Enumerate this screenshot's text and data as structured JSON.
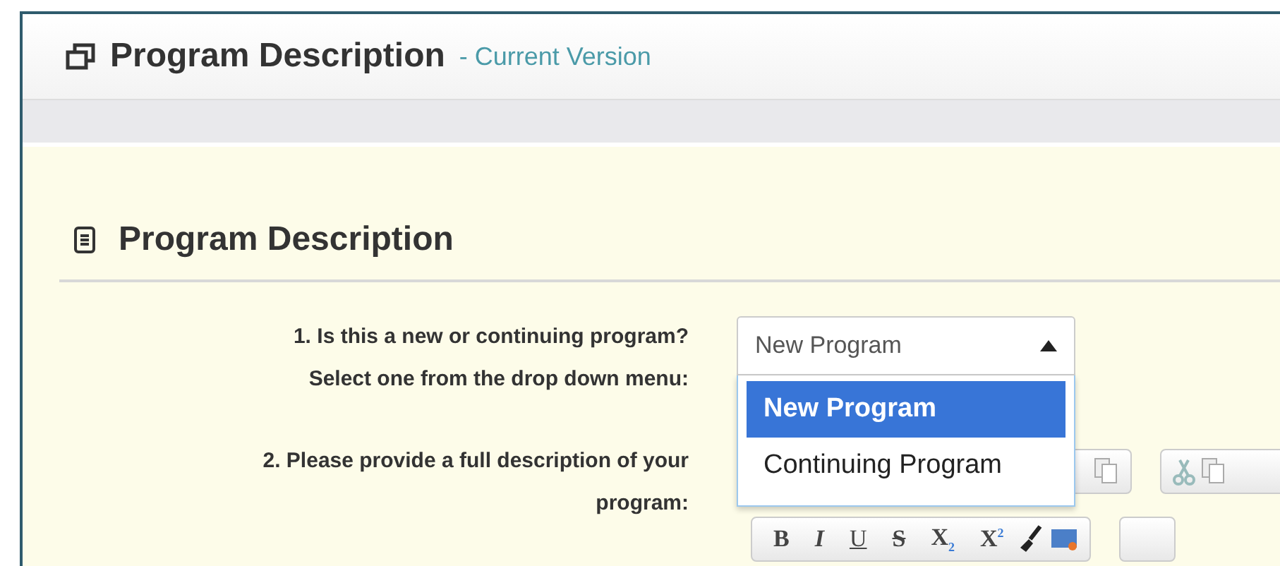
{
  "panel": {
    "title": "Program Description",
    "subtitle": "- Current Version"
  },
  "section": {
    "title": "Program Description"
  },
  "questions": [
    {
      "kind": "select",
      "label_lines": [
        "1. Is this a new or continuing program?",
        "Select one from the drop down menu:"
      ],
      "value": "New Program",
      "expanded": true,
      "options": [
        {
          "label": "New Program",
          "selected": true
        },
        {
          "label": "Continuing Program",
          "selected": false
        }
      ]
    },
    {
      "kind": "editor",
      "label_lines": [
        "2. Please provide a full description of your",
        "program:"
      ],
      "format_buttons": [
        "B",
        "I",
        "U",
        "S",
        "X$_{2}$",
        "X$^{2}$"
      ]
    }
  ]
}
